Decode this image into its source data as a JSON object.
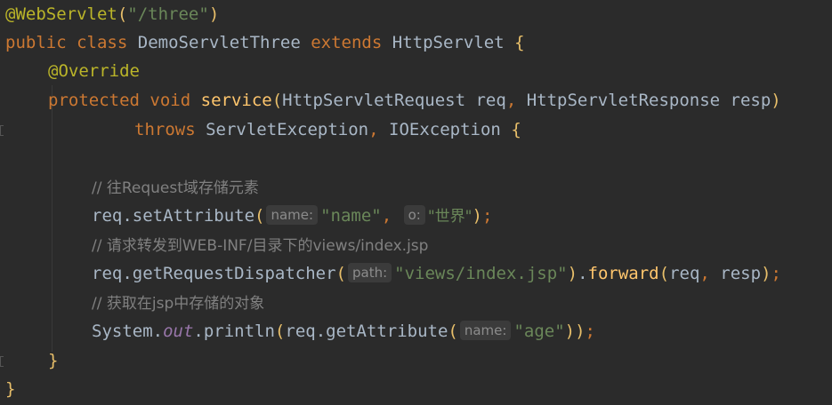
{
  "code": {
    "line1": {
      "annotation": "@WebServlet",
      "paren_open": "(",
      "string": "\"/three\"",
      "paren_close": ")"
    },
    "line2": {
      "kw_public": "public",
      "kw_class": "class",
      "class_name": "DemoServletThree",
      "kw_extends": "extends",
      "super_name": "HttpServlet",
      "brace": "{"
    },
    "line3": {
      "annotation": "@Override"
    },
    "line4": {
      "kw_protected": "protected",
      "kw_void": "void",
      "method": "service",
      "paren_open": "(",
      "params": "HttpServletRequest req",
      "comma": ",",
      "params2": "HttpServletResponse resp",
      "paren_close": ")"
    },
    "line5": {
      "kw_throws": "throws",
      "exceptions": "ServletException",
      "comma": ",",
      "exceptions2": "IOException",
      "brace": "{"
    },
    "line6": {
      "comment": "// 往Request域存储元素"
    },
    "line7": {
      "call": "req.setAttribute",
      "paren_open": "(",
      "hint1": "name:",
      "arg1": "\"name\"",
      "comma": ",",
      "hint2": "o:",
      "arg2": "\"世界\"",
      "paren_close": ")",
      "semi": ";"
    },
    "line8": {
      "comment": "// 请求转发到WEB-INF/目录下的views/index.jsp"
    },
    "line9": {
      "call": "req.getRequestDispatcher",
      "paren_open": "(",
      "hint1": "path:",
      "arg1": "\"views/index.jsp\"",
      "paren_close": ")",
      "dot": ".",
      "call2": "forward",
      "paren_open2": "(",
      "args2": "req",
      "comma": ",",
      "args2b": "resp",
      "paren_close2": ")",
      "semi": ";"
    },
    "line10": {
      "comment": "// 获取在jsp中存储的对象"
    },
    "line11": {
      "obj": "System.",
      "field": "out",
      "call": ".println",
      "paren_open": "(",
      "call2": "req.getAttribute",
      "paren_open2": "(",
      "hint1": "name:",
      "arg1": "\"age\"",
      "paren_close": "))",
      "semi": ";"
    },
    "line12": {
      "brace": "}"
    },
    "line13": {
      "brace": "}"
    }
  },
  "colors": {
    "background": "#2b2b2b",
    "keyword": "#cc7832",
    "annotation": "#bbb529",
    "string": "#6a8759",
    "comment": "#808080",
    "method": "#ffc66d",
    "field": "#9876aa",
    "text": "#a9b7c6"
  }
}
